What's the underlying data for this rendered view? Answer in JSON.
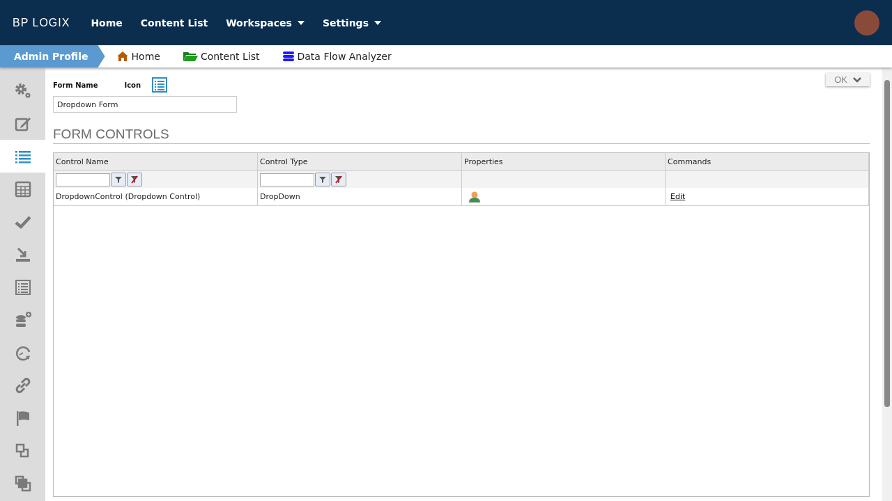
{
  "top_nav": {
    "logo": "BP LOGIX",
    "items": [
      {
        "label": "Home",
        "dropdown": false
      },
      {
        "label": "Content List",
        "dropdown": false
      },
      {
        "label": "Workspaces",
        "dropdown": true
      },
      {
        "label": "Settings",
        "dropdown": true
      }
    ]
  },
  "breadcrumb": {
    "current": "Admin Profile",
    "links": [
      {
        "label": "Home",
        "kind": "home"
      },
      {
        "label": "Content List",
        "kind": "folder"
      },
      {
        "label": "Data Flow Analyzer",
        "kind": "database"
      }
    ]
  },
  "sidebar": {
    "items": [
      {
        "kind": "gears",
        "selected": false
      },
      {
        "kind": "edit",
        "selected": false
      },
      {
        "kind": "list",
        "selected": true
      },
      {
        "kind": "table",
        "selected": false
      },
      {
        "kind": "check",
        "selected": false
      },
      {
        "kind": "import",
        "selected": false
      },
      {
        "kind": "form",
        "selected": false
      },
      {
        "kind": "database",
        "selected": false
      },
      {
        "kind": "timer",
        "selected": false
      },
      {
        "kind": "link",
        "selected": false
      },
      {
        "kind": "flag",
        "selected": false
      },
      {
        "kind": "copy",
        "selected": false
      },
      {
        "kind": "clone",
        "selected": false
      }
    ]
  },
  "form": {
    "name_label": "Form Name",
    "icon_label": "Icon",
    "name_value": "Dropdown Form",
    "ok_button": "OK"
  },
  "section_title": "FORM CONTROLS",
  "table": {
    "columns": [
      "Control Name",
      "Control Type",
      "Properties",
      "Commands"
    ],
    "filters": [
      true,
      true,
      false,
      false
    ],
    "rows": [
      {
        "control_name": "DropdownControl (Dropdown Control)",
        "control_type": "DropDown",
        "command": "Edit"
      }
    ]
  }
}
